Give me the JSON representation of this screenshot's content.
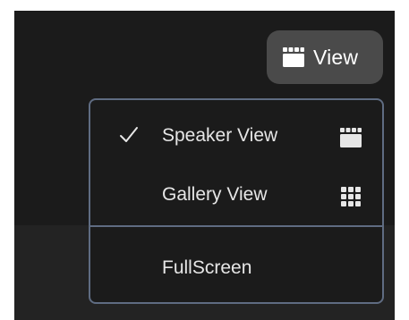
{
  "toolbar": {
    "view_button_label": "View",
    "view_button_icon": "speaker-view-icon"
  },
  "view_menu": {
    "items": [
      {
        "label": "Speaker View",
        "checked": true,
        "icon": "speaker-view-icon"
      },
      {
        "label": "Gallery View",
        "checked": false,
        "icon": "gallery-view-icon"
      }
    ],
    "fullscreen_label": "FullScreen"
  },
  "colors": {
    "window_background": "#1b1b1b",
    "lower_band": "#232323",
    "button_background": "#4a4a4a",
    "menu_border": "#5f6c82",
    "text": "#e6e6e6"
  }
}
